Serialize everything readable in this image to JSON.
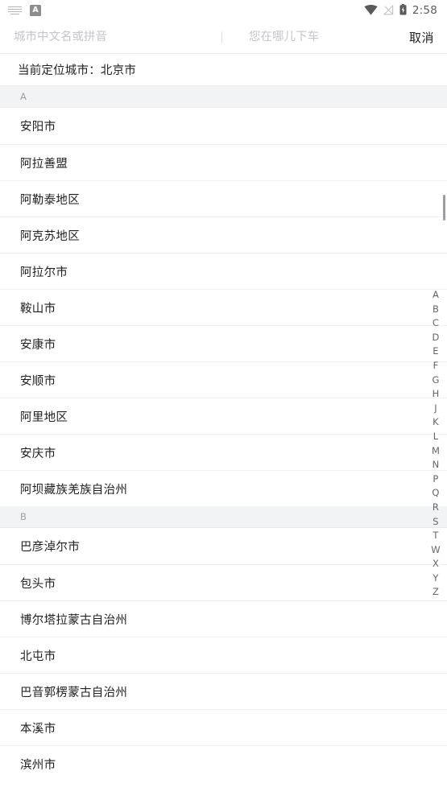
{
  "statusbar": {
    "keyboard_icon": "keyboard-icon",
    "app_badge_icon": "app-badge-icon",
    "app_badge_letter": "A",
    "wifi_icon": "wifi-icon",
    "signal_icon": "signal-off-icon",
    "battery_icon": "battery-charging-icon",
    "time": "2:58"
  },
  "search": {
    "city_placeholder": "城市中文名或拼音",
    "city_value": "",
    "destination_placeholder": "您在哪儿下车",
    "destination_value": "",
    "cancel_label": "取消"
  },
  "location": {
    "current_city_text": "当前定位城市：北京市"
  },
  "list": {
    "sections": [
      {
        "letter": "A",
        "cities": [
          "安阳市",
          "阿拉善盟",
          "阿勒泰地区",
          "阿克苏地区",
          "阿拉尔市",
          "鞍山市",
          "安康市",
          "安顺市",
          "阿里地区",
          "安庆市",
          "阿坝藏族羌族自治州"
        ]
      },
      {
        "letter": "B",
        "cities": [
          "巴彦淖尔市",
          "包头市",
          "博尔塔拉蒙古自治州",
          "北屯市",
          "巴音郭楞蒙古自治州",
          "本溪市",
          "滨州市"
        ]
      }
    ]
  },
  "alpha_index": {
    "letters": [
      "A",
      "B",
      "C",
      "D",
      "E",
      "F",
      "G",
      "H",
      "J",
      "K",
      "L",
      "M",
      "N",
      "P",
      "Q",
      "R",
      "S",
      "T",
      "W",
      "X",
      "Y",
      "Z"
    ]
  },
  "colors": {
    "background": "#ffffff",
    "section_header_bg": "#f1f3f5",
    "divider": "#f0f1f3",
    "primary_text": "#1f1f1f",
    "muted_text": "#9ba0a6",
    "placeholder_text": "#c3c6cb",
    "scrollbar_thumb": "#9a9da1"
  }
}
